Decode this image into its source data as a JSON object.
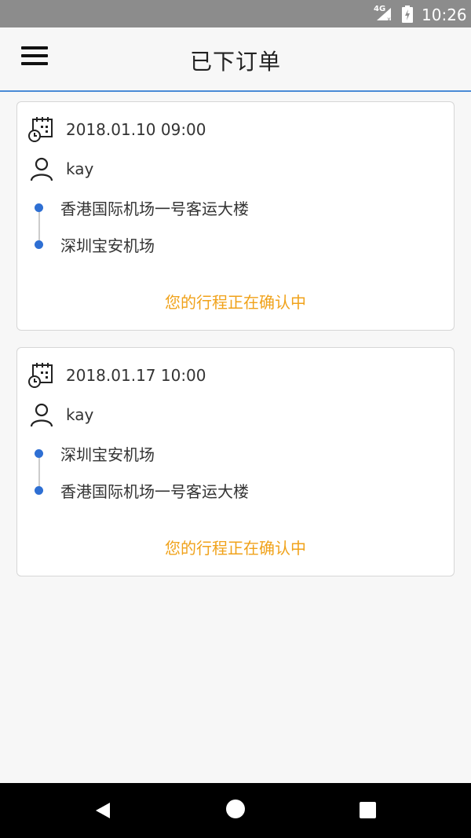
{
  "status_bar": {
    "network": "4G",
    "time": "10:26"
  },
  "header": {
    "title": "已下订单"
  },
  "orders": [
    {
      "datetime": "2018.01.10 09:00",
      "user": "kay",
      "from": "香港国际机场一号客运大楼",
      "to": "深圳宝安机场",
      "status": "您的行程正在确认中"
    },
    {
      "datetime": "2018.01.17 10:00",
      "user": "kay",
      "from": "深圳宝安机场",
      "to": "香港国际机场一号客运大楼",
      "status": "您的行程正在确认中"
    }
  ],
  "colors": {
    "accent": "#4a8bd6",
    "dot": "#2e6fd3",
    "status": "#f0a21a"
  }
}
